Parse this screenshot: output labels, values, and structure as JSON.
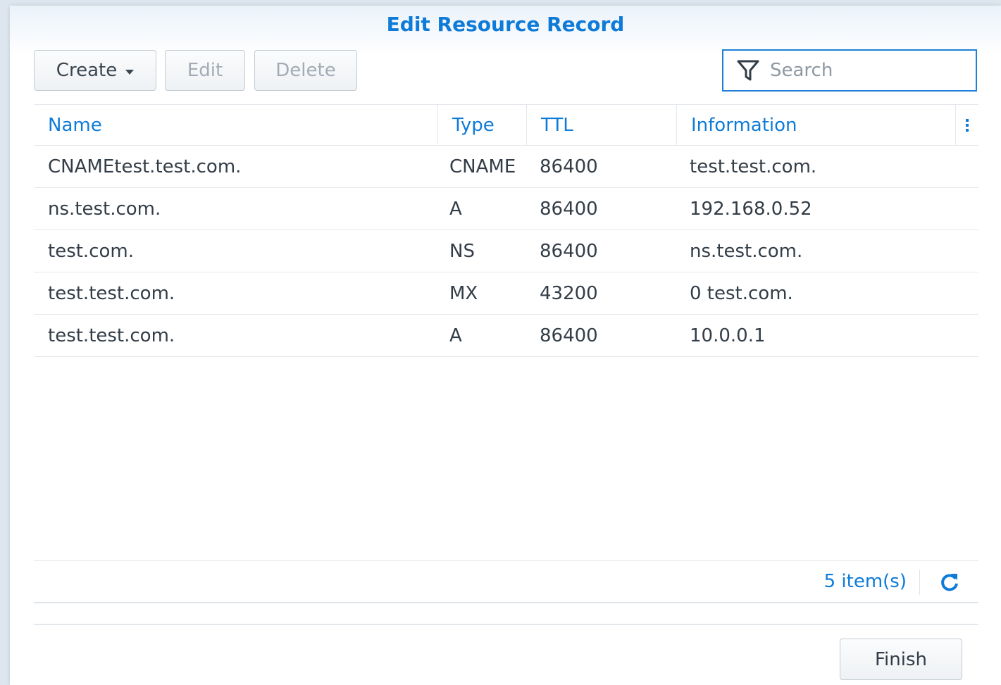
{
  "dialog": {
    "title": "Edit Resource Record"
  },
  "toolbar": {
    "create_label": "Create",
    "edit_label": "Edit",
    "delete_label": "Delete",
    "search_placeholder": "Search"
  },
  "table": {
    "columns": [
      "Name",
      "Type",
      "TTL",
      "Information"
    ],
    "rows": [
      {
        "name": "CNAMEtest.test.com.",
        "type": "CNAME",
        "ttl": "86400",
        "info": "test.test.com."
      },
      {
        "name": "ns.test.com.",
        "type": "A",
        "ttl": "86400",
        "info": "192.168.0.52"
      },
      {
        "name": "test.com.",
        "type": "NS",
        "ttl": "86400",
        "info": "ns.test.com."
      },
      {
        "name": "test.test.com.",
        "type": "MX",
        "ttl": "43200",
        "info": "0 test.com."
      },
      {
        "name": "test.test.com.",
        "type": "A",
        "ttl": "86400",
        "info": "10.0.0.1"
      }
    ]
  },
  "footer": {
    "count": "5 item(s)",
    "finish_label": "Finish"
  },
  "colors": {
    "accent": "#0e7bd8",
    "text": "#333d47",
    "disabled": "#a3acb5"
  },
  "icons": [
    "caret-down-icon",
    "filter-icon",
    "more-vertical-icon",
    "refresh-icon"
  ]
}
